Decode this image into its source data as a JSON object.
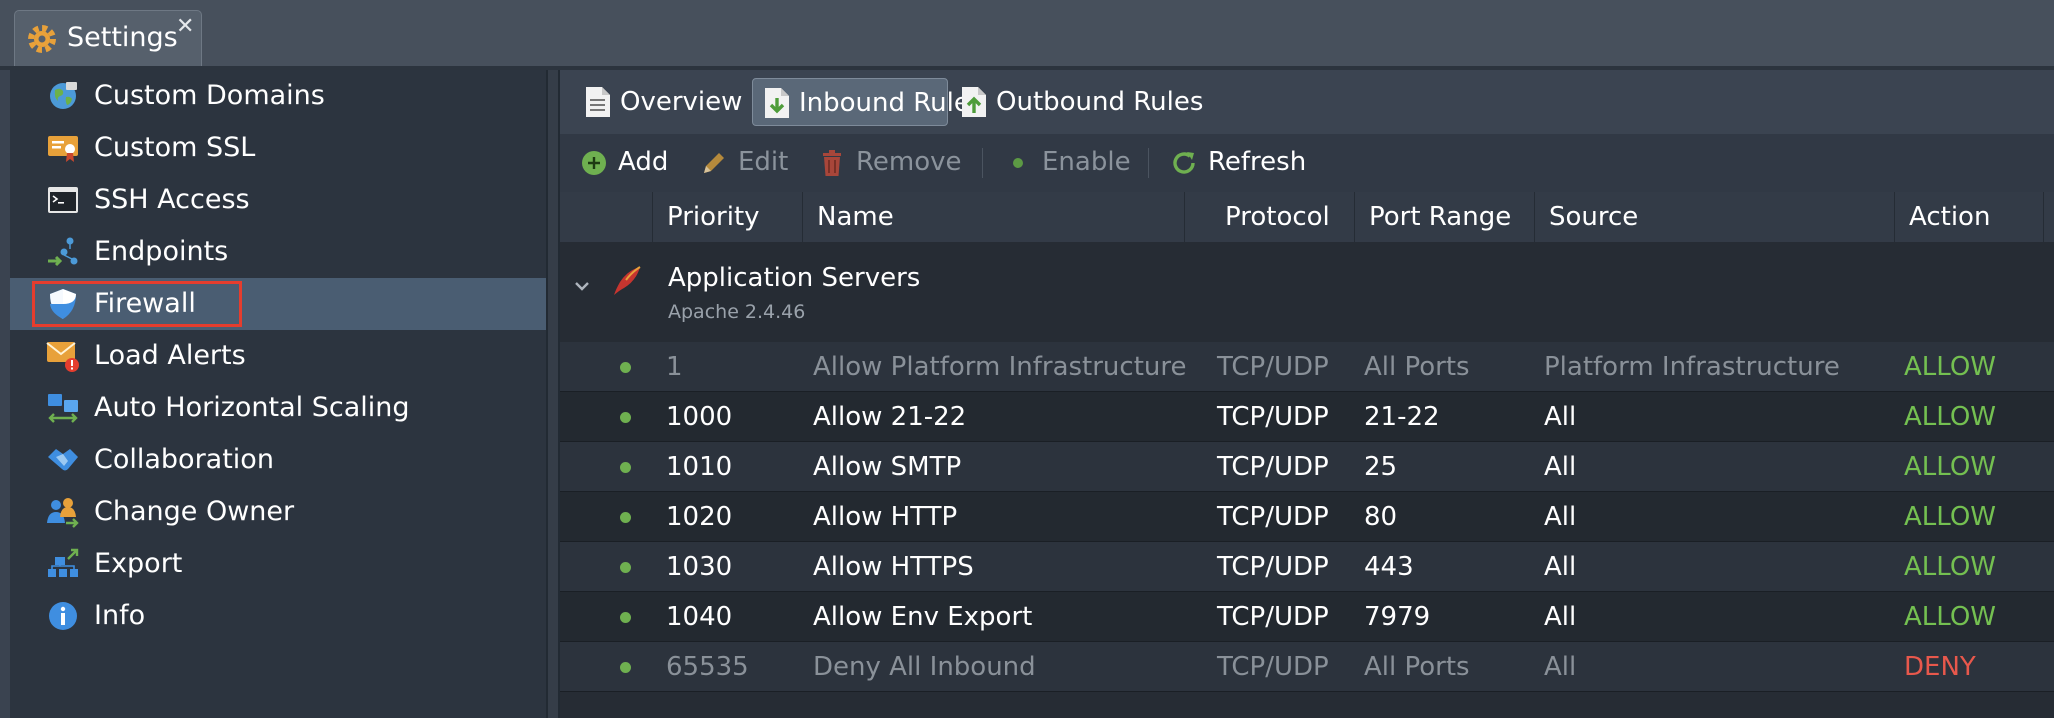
{
  "window": {
    "tab_title": "Settings"
  },
  "sidebar": {
    "items": [
      {
        "label": "Custom Domains",
        "icon": "globe-icon"
      },
      {
        "label": "Custom SSL",
        "icon": "certificate-icon"
      },
      {
        "label": "SSH Access",
        "icon": "terminal-icon"
      },
      {
        "label": "Endpoints",
        "icon": "endpoints-icon"
      },
      {
        "label": "Firewall",
        "icon": "shield-icon",
        "selected": true
      },
      {
        "label": "Load Alerts",
        "icon": "mail-alert-icon"
      },
      {
        "label": "Auto Horizontal Scaling",
        "icon": "scaling-icon"
      },
      {
        "label": "Collaboration",
        "icon": "handshake-icon"
      },
      {
        "label": "Change Owner",
        "icon": "users-icon"
      },
      {
        "label": "Export",
        "icon": "export-icon"
      },
      {
        "label": "Info",
        "icon": "info-icon"
      }
    ]
  },
  "tabs": {
    "overview": "Overview",
    "inbound": "Inbound Rules",
    "outbound": "Outbound Rules",
    "active": "inbound"
  },
  "toolbar": {
    "add": "Add",
    "edit": "Edit",
    "remove": "Remove",
    "enable": "Enable",
    "refresh": "Refresh"
  },
  "table": {
    "columns": [
      "Priority",
      "Name",
      "Protocol",
      "Port Range",
      "Source",
      "Action"
    ],
    "group": {
      "title": "Application Servers",
      "subtitle": "Apache 2.4.46"
    },
    "rows": [
      {
        "priority": "1",
        "name": "Allow Platform Infrastructure",
        "protocol": "TCP/UDP",
        "port_range": "All Ports",
        "source": "Platform Infrastructure",
        "action": "ALLOW",
        "muted": true
      },
      {
        "priority": "1000",
        "name": "Allow 21-22",
        "protocol": "TCP/UDP",
        "port_range": "21-22",
        "source": "All",
        "action": "ALLOW",
        "muted": false
      },
      {
        "priority": "1010",
        "name": "Allow SMTP",
        "protocol": "TCP/UDP",
        "port_range": "25",
        "source": "All",
        "action": "ALLOW",
        "muted": false
      },
      {
        "priority": "1020",
        "name": "Allow HTTP",
        "protocol": "TCP/UDP",
        "port_range": "80",
        "source": "All",
        "action": "ALLOW",
        "muted": false
      },
      {
        "priority": "1030",
        "name": "Allow HTTPS",
        "protocol": "TCP/UDP",
        "port_range": "443",
        "source": "All",
        "action": "ALLOW",
        "muted": false
      },
      {
        "priority": "1040",
        "name": "Allow Env Export",
        "protocol": "TCP/UDP",
        "port_range": "7979",
        "source": "All",
        "action": "ALLOW",
        "muted": false
      },
      {
        "priority": "65535",
        "name": "Deny All Inbound",
        "protocol": "TCP/UDP",
        "port_range": "All Ports",
        "source": "All",
        "action": "DENY",
        "muted": true
      }
    ]
  },
  "colors": {
    "allow": "#74c051",
    "deny": "#e8584c",
    "selection": "#4a5d72",
    "highlight": "#e53d2e"
  }
}
